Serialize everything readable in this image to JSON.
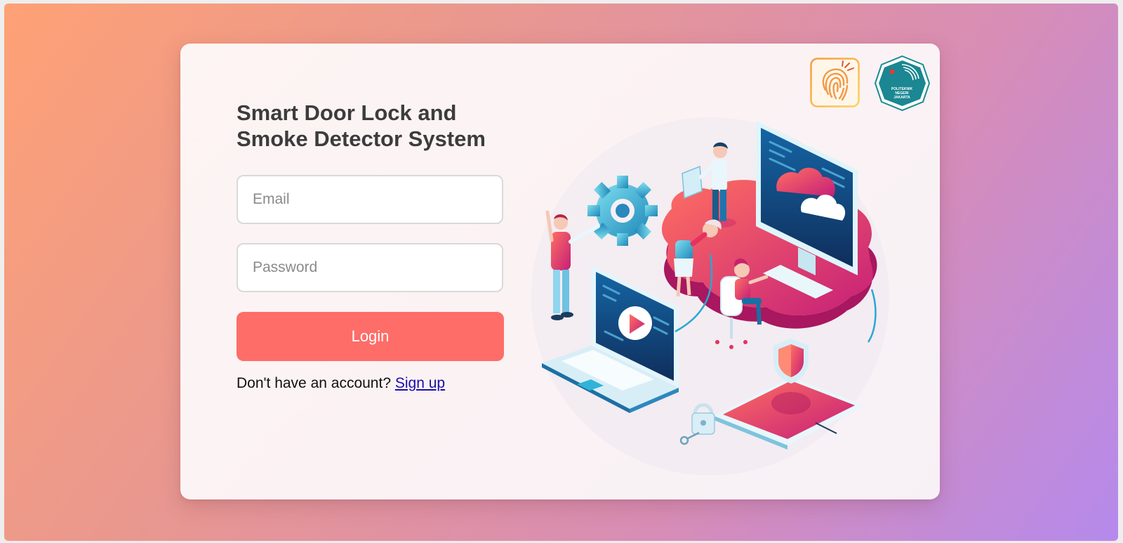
{
  "app": {
    "title": "Smart Door Lock and Smoke Detector System"
  },
  "form": {
    "email_placeholder": "Email",
    "password_placeholder": "Password",
    "login_label": "Login",
    "signup_prompt": "Don't have an account?",
    "signup_link": "Sign up"
  },
  "logos": {
    "fingerprint_icon": "fingerprint-icon",
    "institution_logo_text": "POLITEKNIK NEGERI JAKARTA"
  },
  "colors": {
    "accent": "#fe6d68",
    "title_text": "#3c3c3c",
    "link": "#1a0dab",
    "gradient_start": "#fea175",
    "gradient_end": "#b58aec"
  }
}
